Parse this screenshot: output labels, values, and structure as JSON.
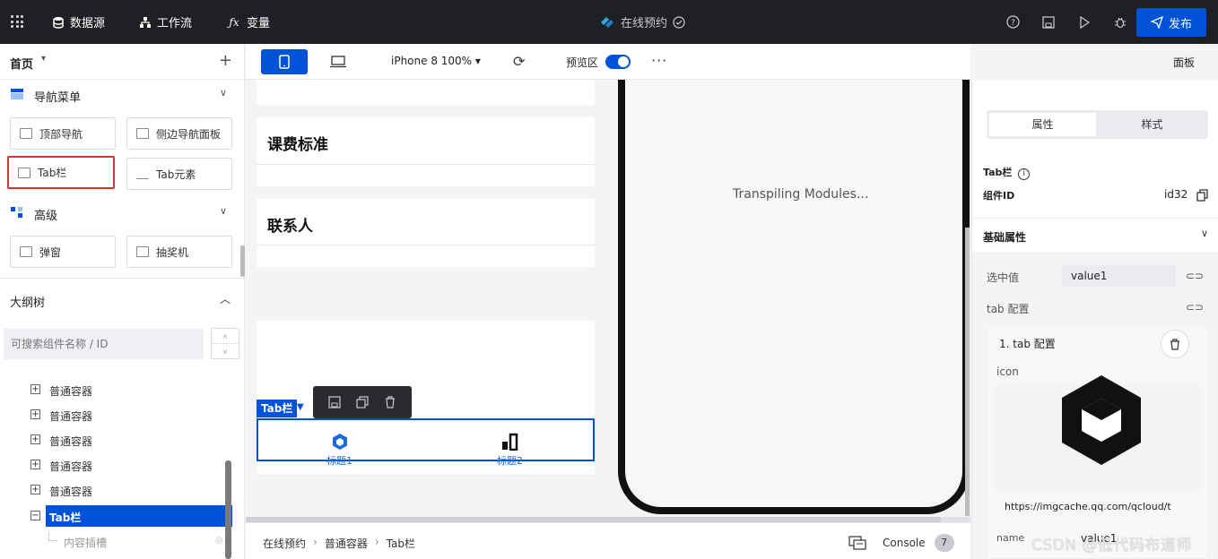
{
  "topbar": {
    "datasource": "数据源",
    "workflow": "工作流",
    "variables": "变量",
    "project_title": "在线预约",
    "publish": "发布",
    "colors": {
      "bg": "#1f2023",
      "publish": "#0052d9"
    }
  },
  "left": {
    "page": "首页",
    "nav_section": "导航菜单",
    "components": [
      {
        "label": "顶部导航"
      },
      {
        "label": "侧边导航面板"
      },
      {
        "label": "Tab栏"
      },
      {
        "label": "Tab元素"
      }
    ],
    "advanced_section": "高级",
    "adv_components": [
      {
        "label": "弹窗"
      },
      {
        "label": "抽奖机"
      }
    ],
    "outline_title": "大纲树",
    "search_placeholder": "可搜索组件名称 / ID",
    "tree": [
      {
        "label": "普通容器"
      },
      {
        "label": "普通容器"
      },
      {
        "label": "普通容器"
      },
      {
        "label": "普通容器"
      },
      {
        "label": "普通容器"
      },
      {
        "label": "Tab栏"
      },
      {
        "label": "内容插槽"
      }
    ]
  },
  "toolbar": {
    "device": "iPhone 8 100%",
    "preview": "预览区",
    "panel": "面板"
  },
  "canvas": {
    "card1": "课费标准",
    "card2": "联系人",
    "tag": "Tab栏",
    "tab1": "标题1",
    "tab2": "标题2",
    "loading": "Transpiling Modules..."
  },
  "bottom": {
    "crumbs": [
      "在线预约",
      "普通容器",
      "Tab栏"
    ],
    "console": "Console",
    "console_count": "7"
  },
  "right": {
    "tab_props": "属性",
    "tab_style": "样式",
    "comp_name": "Tab栏",
    "comp_id_label": "组件ID",
    "comp_id": "id32",
    "base_props": "基础属性",
    "selected_label": "选中值",
    "selected_value": "value1",
    "tab_config": "tab 配置",
    "cfg_item": "1. tab 配置",
    "icon_label": "icon",
    "url": "https://imgcache.qq.com/qcloud/t",
    "name_label": "name",
    "name_value": "value1"
  },
  "watermark": "CSDN @低代码布道师"
}
